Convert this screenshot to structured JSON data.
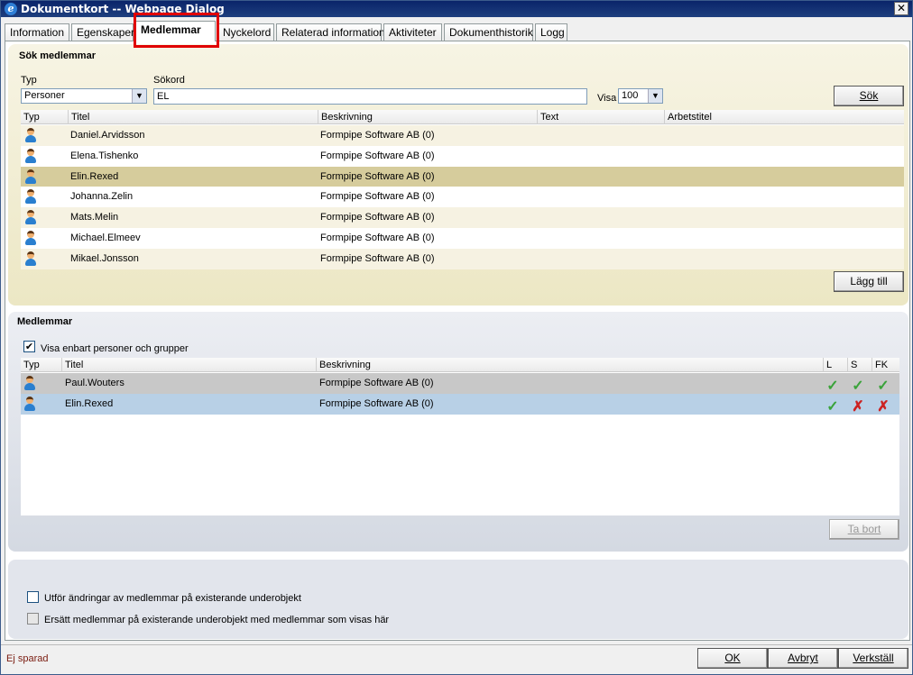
{
  "window": {
    "title": "Dokumentkort -- Webpage Dialog",
    "close": "✕"
  },
  "tabs": [
    "Information",
    "Egenskaper",
    "Medlemmar",
    "Nyckelord",
    "Relaterad information",
    "Aktiviteter",
    "Dokumenthistorik",
    "Logg"
  ],
  "active_tab": "Medlemmar",
  "search": {
    "title": "Sök medlemmar",
    "typ_label": "Typ",
    "typ_value": "Personer",
    "sokord_label": "Sökord",
    "sokord_value": "EL",
    "visa_label": "Visa",
    "visa_value": "100",
    "search_button": "Sök",
    "columns": [
      "Typ",
      "Titel",
      "Beskrivning",
      "Text",
      "Arbetstitel"
    ],
    "rows": [
      {
        "titel": "Daniel.Arvidsson",
        "beskrivning": "Formpipe Software AB (0)",
        "selected": false
      },
      {
        "titel": "Elena.Tishenko",
        "beskrivning": "Formpipe Software AB (0)",
        "selected": false
      },
      {
        "titel": "Elin.Rexed",
        "beskrivning": "Formpipe Software AB (0)",
        "selected": true
      },
      {
        "titel": "Johanna.Zelin",
        "beskrivning": "Formpipe Software AB (0)",
        "selected": false
      },
      {
        "titel": "Mats.Melin",
        "beskrivning": "Formpipe Software AB (0)",
        "selected": false
      },
      {
        "titel": "Michael.Elmeev",
        "beskrivning": "Formpipe Software AB (0)",
        "selected": false
      },
      {
        "titel": "Mikael.Jonsson",
        "beskrivning": "Formpipe Software AB (0)",
        "selected": false
      }
    ],
    "add_button": "Lägg till"
  },
  "members": {
    "title": "Medlemmar",
    "filter_checkbox": "Visa enbart personer och grupper",
    "filter_checked": true,
    "columns": [
      "Typ",
      "Titel",
      "Beskrivning",
      "L",
      "S",
      "FK"
    ],
    "rows": [
      {
        "titel": "Paul.Wouters",
        "beskrivning": "Formpipe Software AB (0)",
        "L": true,
        "S": true,
        "FK": true
      },
      {
        "titel": "Elin.Rexed",
        "beskrivning": "Formpipe Software AB (0)",
        "L": true,
        "S": false,
        "FK": false
      }
    ],
    "remove_button": "Ta bort"
  },
  "options": {
    "apply_label": "Utför ändringar av medlemmar på existerande underobjekt",
    "replace_label": "Ersätt medlemmar på existerande underobjekt med medlemmar som visas här"
  },
  "footer": {
    "status": "Ej sparad",
    "ok": "OK",
    "cancel": "Avbryt",
    "apply": "Verkställ"
  },
  "colors": {
    "selected_row": "#d6cc9c",
    "member_row_1": "#c8c8c8",
    "member_row_2": "#b8d0e6",
    "highlight": "#e00000"
  }
}
